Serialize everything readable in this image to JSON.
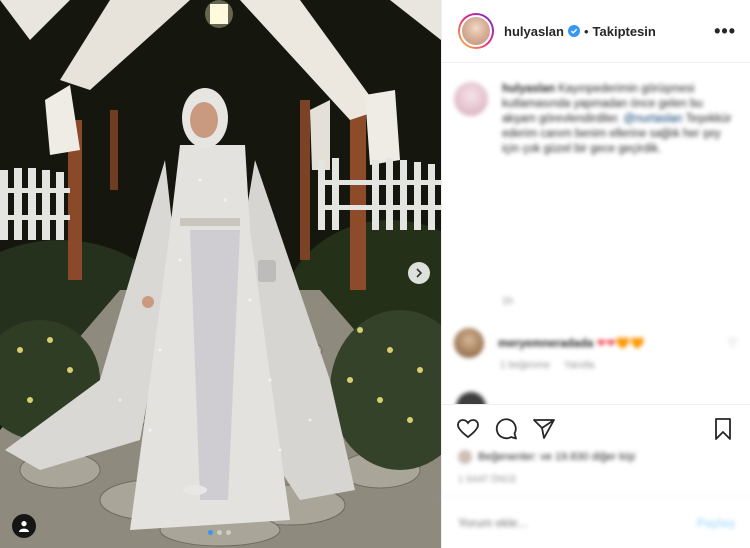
{
  "header": {
    "username": "hulyaslan",
    "separator": "•",
    "follow_label": "Takiptesin",
    "more_label": "•••"
  },
  "caption": {
    "username": "hulyaslan",
    "text_1": "Kayınpederimin görüşmesi kutlamasında yapmadan önce gelen bu akşam görevlendirdiler.",
    "mention": "@nurtaslan",
    "text_2": "Teşekkür ederim canım benim ellerine sağlık her şey için çok güzel bir gece geçirdik.",
    "time": "1h"
  },
  "comment": {
    "username": "meryemneradada",
    "text": "❤❤🧡🧡",
    "likes": "1 beğenme",
    "reply": "Yanıtla"
  },
  "likes": {
    "text": "Beğenenler: ve 19.830 diğer kişi",
    "date": "1 saat önce"
  },
  "add_comment": {
    "placeholder": "Yorum ekle...",
    "post_label": "Paylaş"
  },
  "carousel": {
    "count": 3,
    "active": 0
  },
  "colors": {
    "verified": "#3897f0",
    "active_dot": "#3897f0",
    "post_button": "#b2dffc",
    "heart_red": "#ed4956",
    "heart_orange": "#f79b3d"
  }
}
